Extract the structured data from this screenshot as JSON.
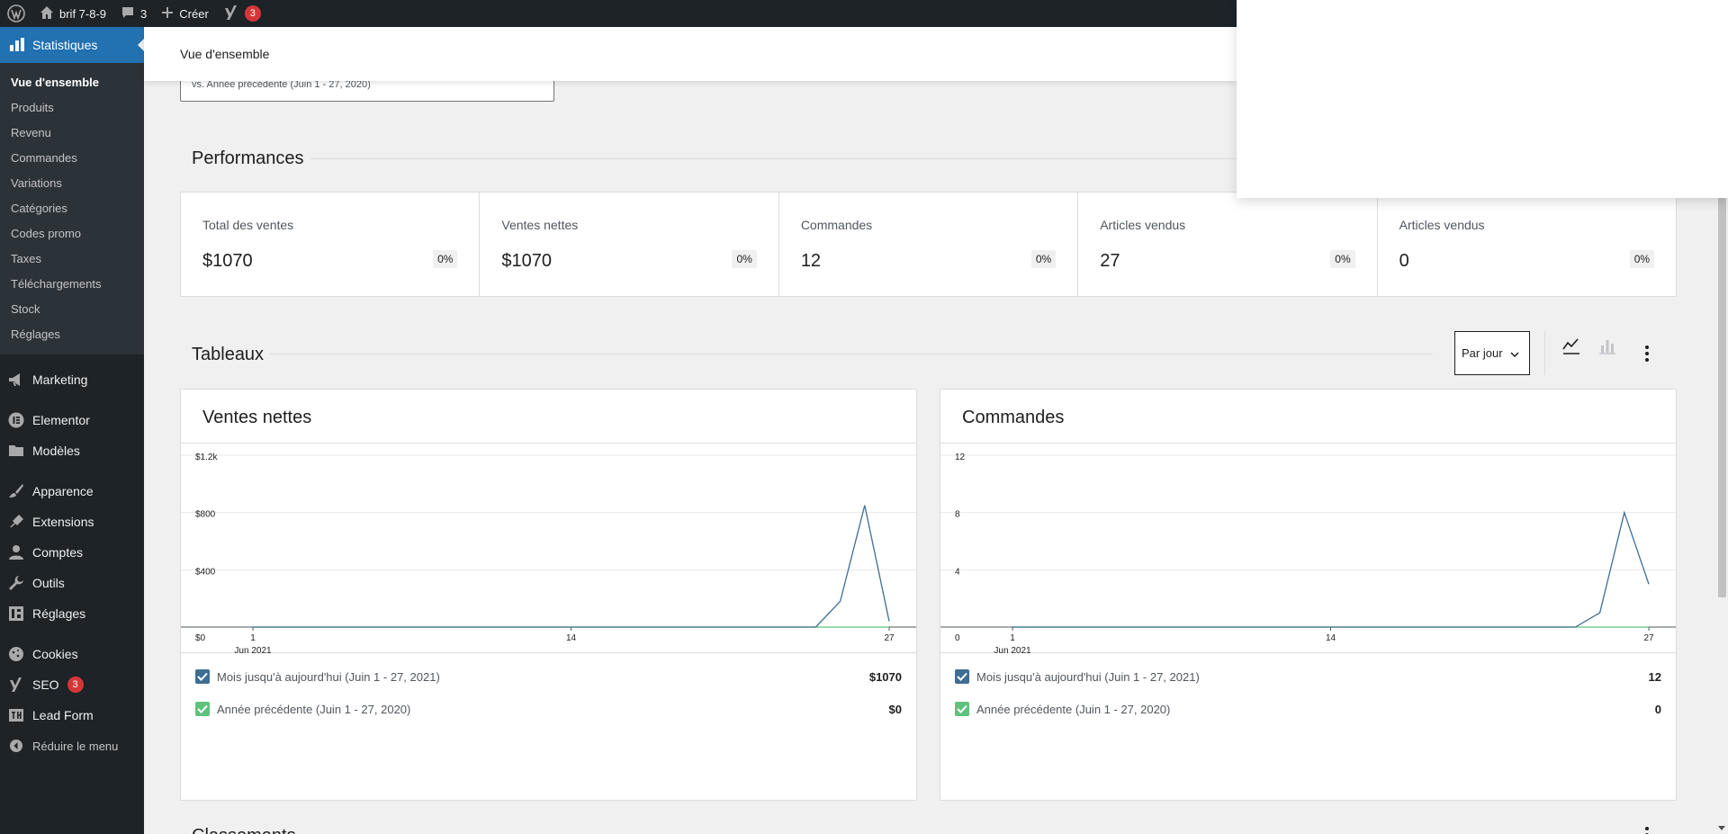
{
  "adminbar": {
    "site_name": "brif 7-8-9",
    "comments_count": "3",
    "create_label": "Créer",
    "yoast_badge": "3"
  },
  "sidebar": {
    "current": "Statistiques",
    "submenu": [
      "Vue d'ensemble",
      "Produits",
      "Revenu",
      "Commandes",
      "Variations",
      "Catégories",
      "Codes promo",
      "Taxes",
      "Téléchargements",
      "Stock",
      "Réglages"
    ],
    "group1": [
      {
        "label": "Marketing",
        "icon": "megaphone-icon"
      }
    ],
    "group2": [
      {
        "label": "Elementor",
        "icon": "elementor-icon"
      },
      {
        "label": "Modèles",
        "icon": "folder-icon"
      }
    ],
    "group3": [
      {
        "label": "Apparence",
        "icon": "brush-icon"
      },
      {
        "label": "Extensions",
        "icon": "plugin-icon"
      },
      {
        "label": "Comptes",
        "icon": "user-icon"
      },
      {
        "label": "Outils",
        "icon": "wrench-icon"
      },
      {
        "label": "Réglages",
        "icon": "settings-icon"
      }
    ],
    "group4": [
      {
        "label": "Cookies",
        "icon": "cookie-icon"
      },
      {
        "label": "SEO",
        "icon": "yoast-icon",
        "badge": "3"
      },
      {
        "label": "Lead Form",
        "icon": "leadform-icon"
      }
    ],
    "collapse": "Réduire le menu"
  },
  "header": {
    "title": "Vue d'ensemble"
  },
  "daterange": {
    "compare_text": "vs. Année précédente (Juin 1 - 27, 2020)"
  },
  "performances": {
    "title": "Performances",
    "cards": [
      {
        "label": "Total des ventes",
        "value": "$1070",
        "delta": "0%"
      },
      {
        "label": "Ventes nettes",
        "value": "$1070",
        "delta": "0%"
      },
      {
        "label": "Commandes",
        "value": "12",
        "delta": "0%"
      },
      {
        "label": "Articles vendus",
        "value": "27",
        "delta": "0%"
      },
      {
        "label": "Articles vendus",
        "value": "0",
        "delta": "0%"
      }
    ]
  },
  "tableaux": {
    "title": "Tableaux",
    "interval": "Par jour"
  },
  "colors": {
    "primary_series": "#3e6e94",
    "previous_series": "#5ec27c",
    "accent": "#2271b1",
    "badge": "#d63638"
  },
  "chart_data": [
    {
      "type": "line",
      "title": "Ventes nettes",
      "x_ticks": [
        "1",
        "14",
        "27"
      ],
      "x_sublabel": "Jun 2021",
      "y_ticks": [
        "$0",
        "$400",
        "$800",
        "$1.2k"
      ],
      "ylim": [
        0,
        1200
      ],
      "x": [
        1,
        2,
        3,
        4,
        5,
        6,
        7,
        8,
        9,
        10,
        11,
        12,
        13,
        14,
        15,
        16,
        17,
        18,
        19,
        20,
        21,
        22,
        23,
        24,
        25,
        26,
        27
      ],
      "series": [
        {
          "name": "Mois jusqu'à aujourd'hui (Juin 1 - 27, 2021)",
          "values": [
            0,
            0,
            0,
            0,
            0,
            0,
            0,
            0,
            0,
            0,
            0,
            0,
            0,
            0,
            0,
            0,
            0,
            0,
            0,
            0,
            0,
            0,
            0,
            0,
            180,
            850,
            40
          ],
          "total": "$1070"
        },
        {
          "name": "Année précédente (Juin 1 - 27, 2020)",
          "values": [
            0,
            0,
            0,
            0,
            0,
            0,
            0,
            0,
            0,
            0,
            0,
            0,
            0,
            0,
            0,
            0,
            0,
            0,
            0,
            0,
            0,
            0,
            0,
            0,
            0,
            0,
            0
          ],
          "total": "$0"
        }
      ]
    },
    {
      "type": "line",
      "title": "Commandes",
      "x_ticks": [
        "1",
        "14",
        "27"
      ],
      "x_sublabel": "Jun 2021",
      "y_ticks": [
        "0",
        "4",
        "8",
        "12"
      ],
      "ylim": [
        0,
        12
      ],
      "x": [
        1,
        2,
        3,
        4,
        5,
        6,
        7,
        8,
        9,
        10,
        11,
        12,
        13,
        14,
        15,
        16,
        17,
        18,
        19,
        20,
        21,
        22,
        23,
        24,
        25,
        26,
        27
      ],
      "series": [
        {
          "name": "Mois jusqu'à aujourd'hui (Juin 1 - 27, 2021)",
          "values": [
            0,
            0,
            0,
            0,
            0,
            0,
            0,
            0,
            0,
            0,
            0,
            0,
            0,
            0,
            0,
            0,
            0,
            0,
            0,
            0,
            0,
            0,
            0,
            0,
            1,
            8,
            3
          ],
          "total": "12"
        },
        {
          "name": "Année précédente (Juin 1 - 27, 2020)",
          "values": [
            0,
            0,
            0,
            0,
            0,
            0,
            0,
            0,
            0,
            0,
            0,
            0,
            0,
            0,
            0,
            0,
            0,
            0,
            0,
            0,
            0,
            0,
            0,
            0,
            0,
            0,
            0
          ],
          "total": "0"
        }
      ]
    }
  ],
  "next_section_partial": "Classements"
}
